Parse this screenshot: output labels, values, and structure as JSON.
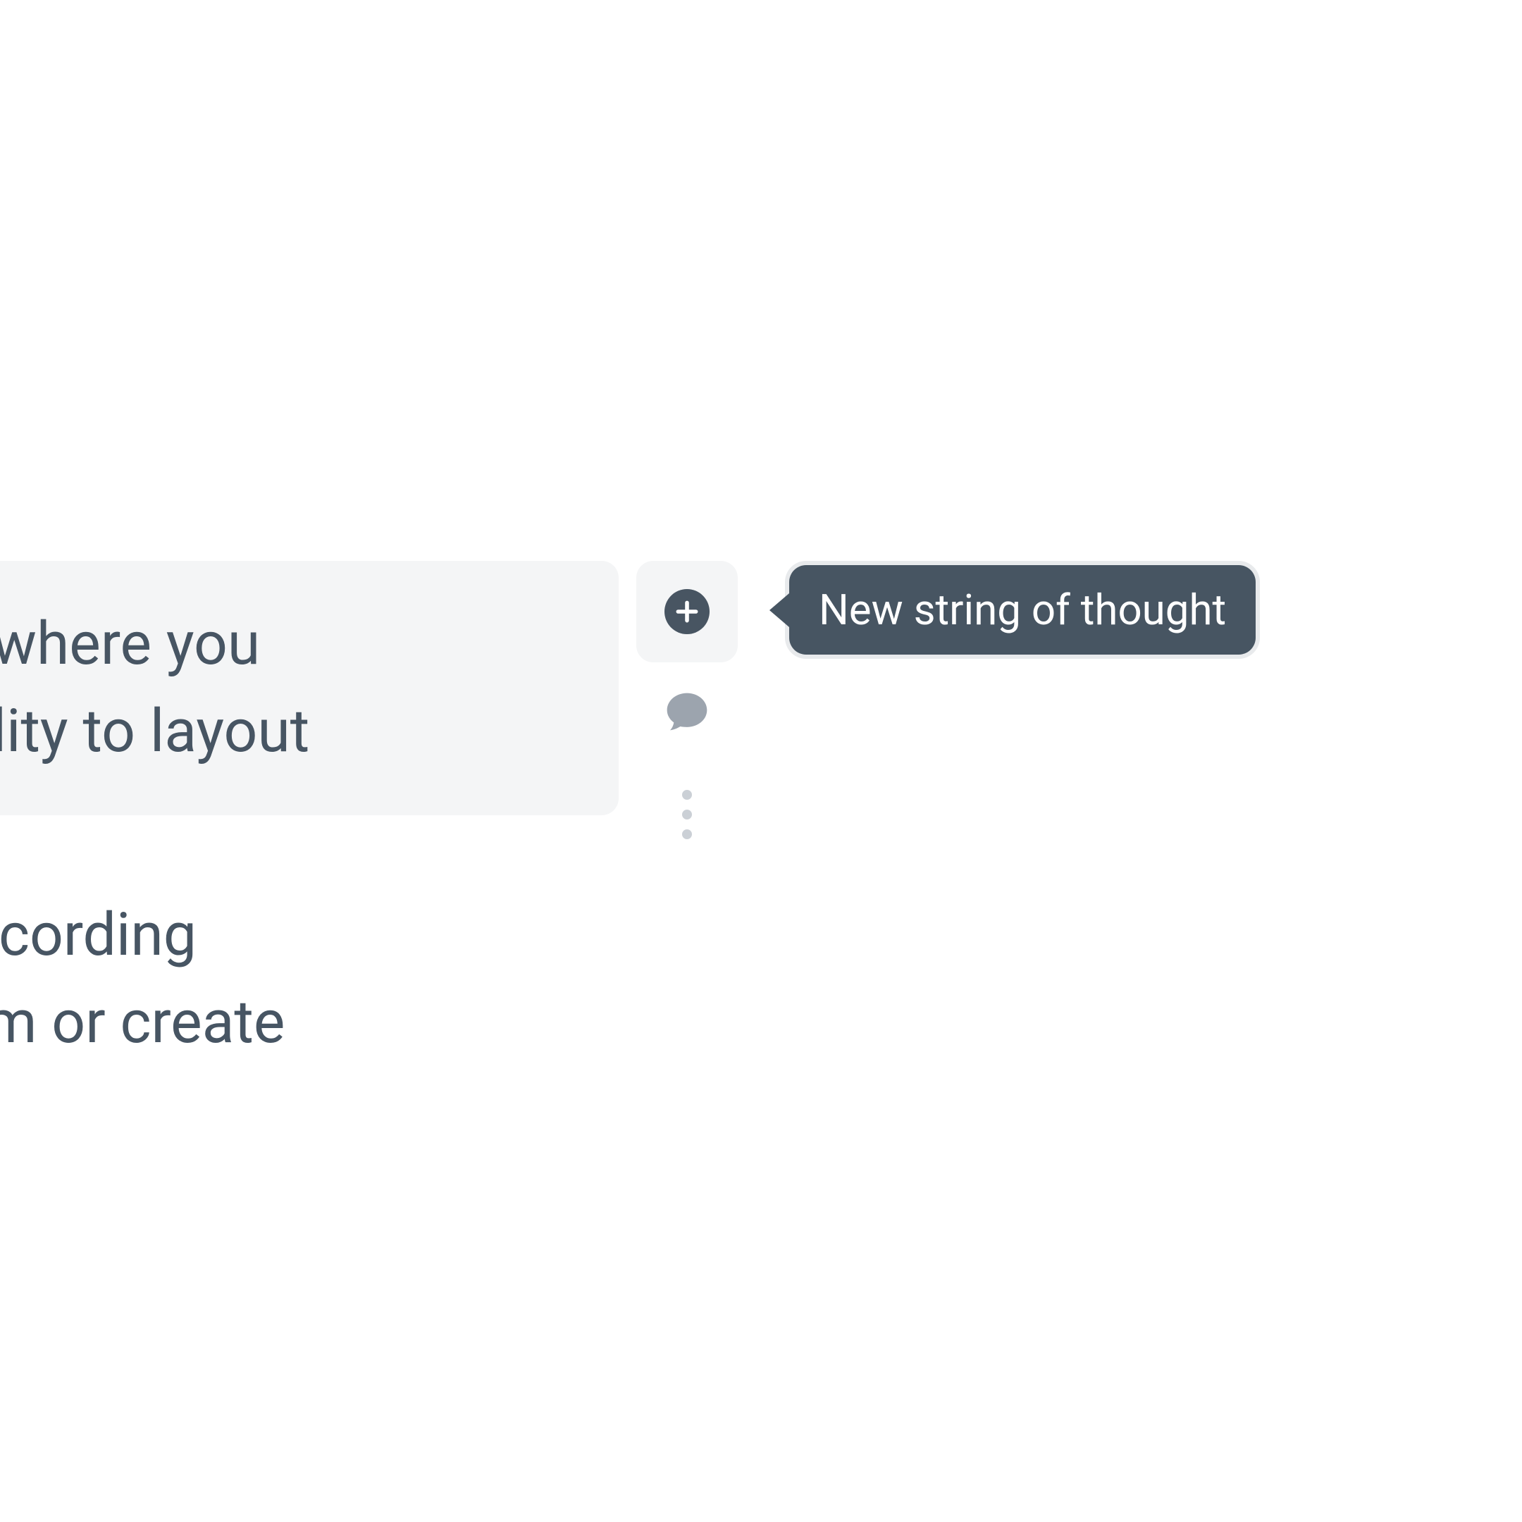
{
  "content": {
    "block_line1": "esearch where you",
    "block_line2": "s the ability to layout",
    "below_line1": "ovide is recording",
    "below_line2": " top of them or create"
  },
  "toolbar": {
    "tooltip_text": "New string of thought"
  }
}
